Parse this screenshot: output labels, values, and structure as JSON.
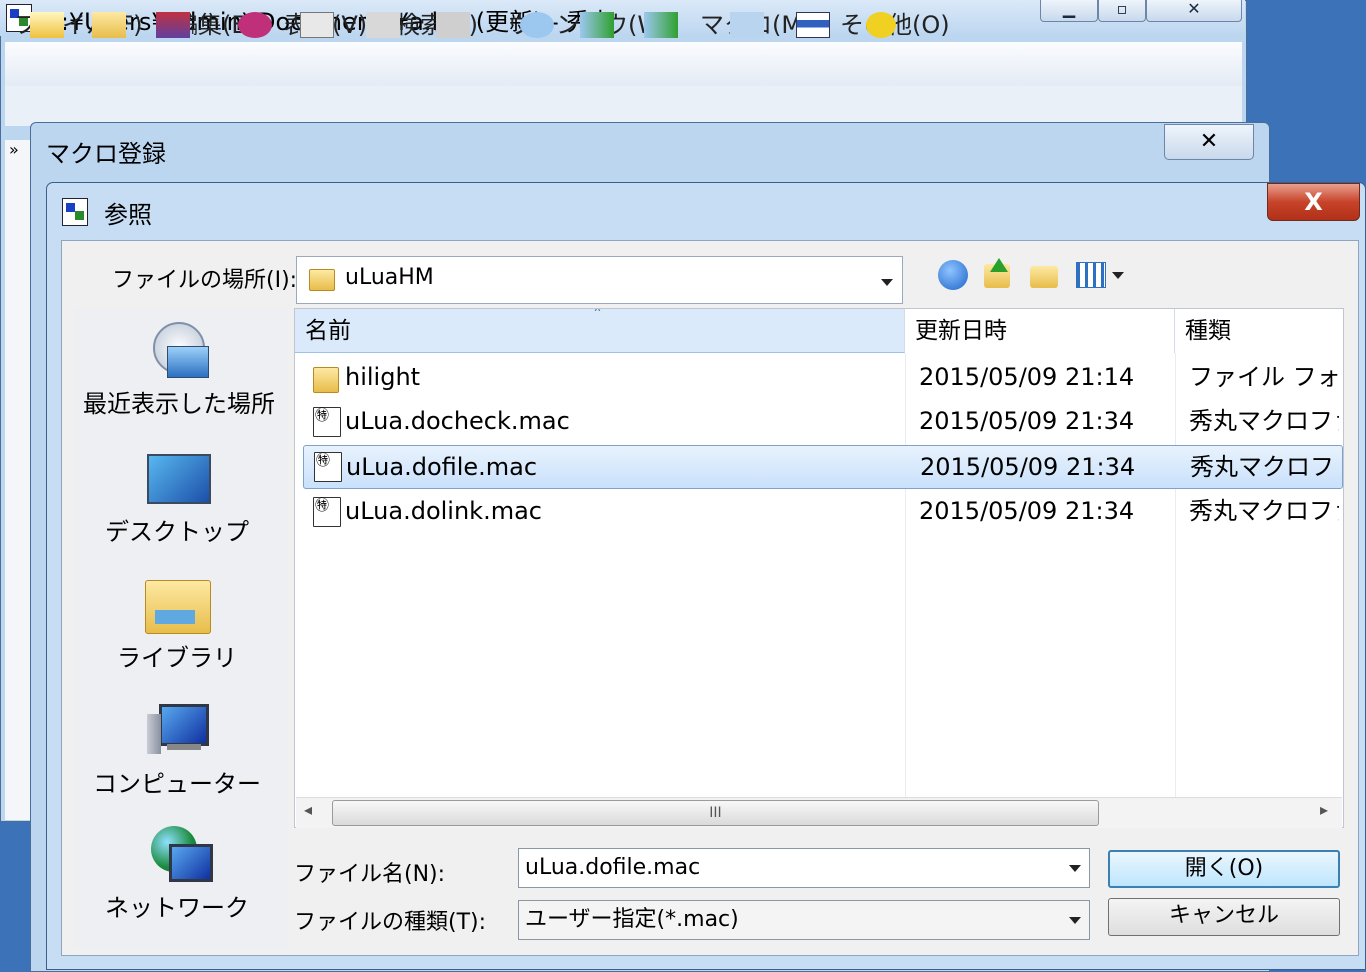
{
  "editor": {
    "title": "C:¥Users¥admin¥Documents¥a.lua (更新) - 秀丸",
    "menu": [
      "ファイル(F)",
      "編集(E)",
      "表示(V)",
      "検索(S)",
      "ウィンドウ(W)",
      "マクロ(M)",
      "その他(O)"
    ],
    "minimize_glyph": "▁",
    "maximize_glyph": "▫",
    "close_glyph": "✕",
    "chevron": "»"
  },
  "macro_dialog": {
    "title": "マクロ登録",
    "close_glyph": "✕"
  },
  "browse_dialog": {
    "title": "参照",
    "close_glyph": "X",
    "lookin_label": "ファイルの場所(I):",
    "lookin_value": "uLuaHM",
    "places": [
      "最近表示した場所",
      "デスクトップ",
      "ライブラリ",
      "コンピューター",
      "ネットワーク"
    ],
    "columns": [
      "名前",
      "更新日時",
      "種類"
    ],
    "sort_glyph": "˄",
    "files": [
      {
        "name": "hilight",
        "date": "2015/05/09 21:14",
        "type": "ファイル フォルダー",
        "kind": "folder"
      },
      {
        "name": "uLua.docheck.mac",
        "date": "2015/05/09 21:34",
        "type": "秀丸マクロファイル",
        "kind": "macro"
      },
      {
        "name": "uLua.dofile.mac",
        "date": "2015/05/09 21:34",
        "type": "秀丸マクロファイル",
        "kind": "macro",
        "selected": true
      },
      {
        "name": "uLua.dolink.mac",
        "date": "2015/05/09 21:34",
        "type": "秀丸マクロファイル",
        "kind": "macro"
      }
    ],
    "scroll_thumb_glyph": "III",
    "scroll_left_glyph": "◂",
    "scroll_right_glyph": "▸",
    "filename_label": "ファイル名(N):",
    "filename_value": "uLua.dofile.mac",
    "filetype_label": "ファイルの種類(T):",
    "filetype_value": "ユーザー指定(*.mac)",
    "open_button": "開く(O)",
    "cancel_button": "キャンセル"
  },
  "colors": {
    "accent": "#3c7fb1",
    "selection": "#c9e1fb",
    "close_red": "#c7442b"
  }
}
